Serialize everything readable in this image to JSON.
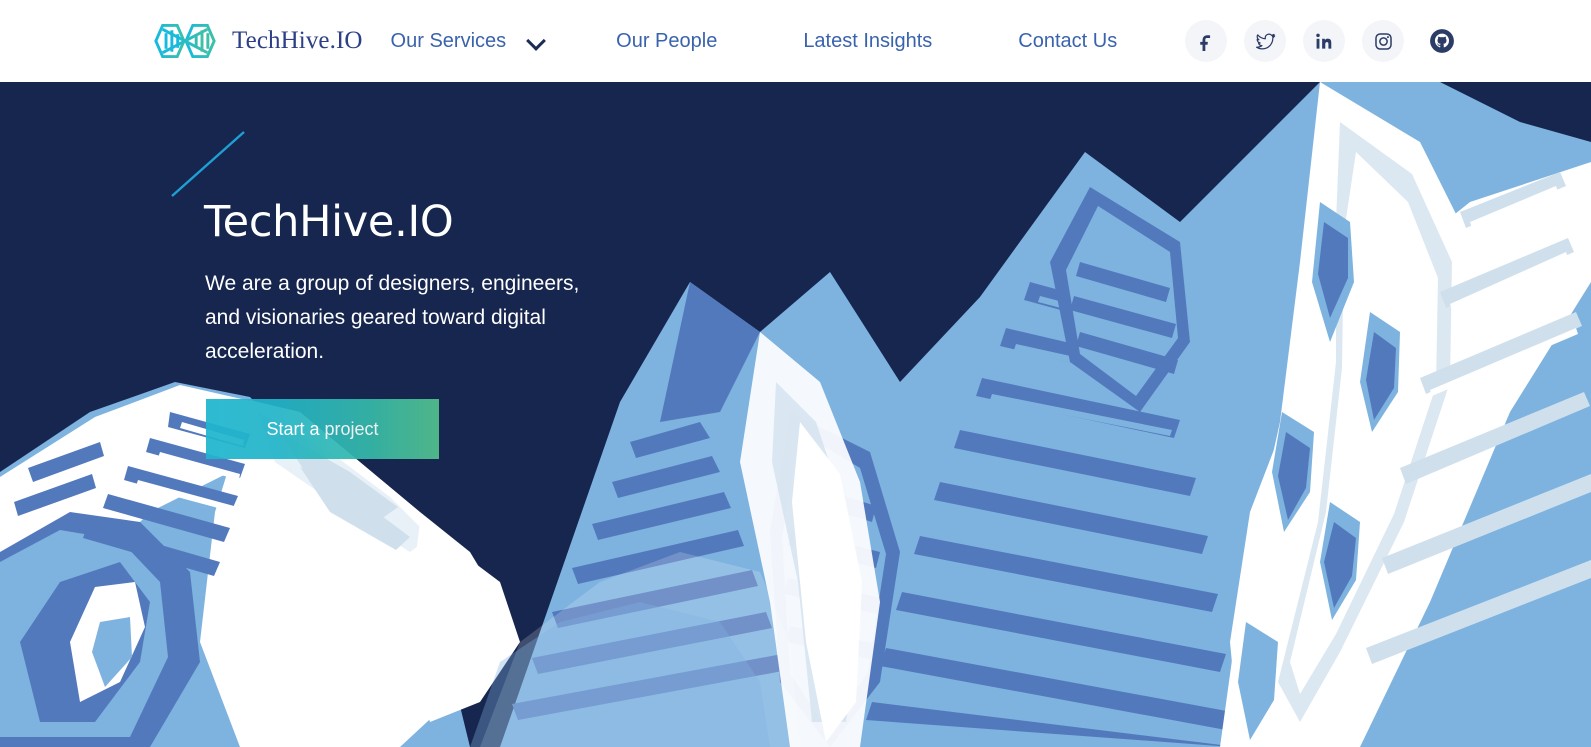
{
  "header": {
    "brand": {
      "name": "TechHive.IO",
      "logo_icon": "infinity-hexagon-logo"
    },
    "nav": [
      {
        "key": "services",
        "label": "Our Services",
        "has_dropdown": true,
        "dropdown_icon": "chevron-down-icon"
      },
      {
        "key": "people",
        "label": "Our People",
        "has_dropdown": false
      },
      {
        "key": "insights",
        "label": "Latest Insights",
        "has_dropdown": false
      },
      {
        "key": "contact",
        "label": "Contact Us",
        "has_dropdown": false
      }
    ],
    "socials": [
      {
        "key": "facebook",
        "icon": "facebook-icon",
        "label": "Facebook"
      },
      {
        "key": "twitter",
        "icon": "twitter-icon",
        "label": "Twitter"
      },
      {
        "key": "linkedin",
        "icon": "linkedin-icon",
        "label": "LinkedIn"
      },
      {
        "key": "instagram",
        "icon": "instagram-icon",
        "label": "Instagram"
      },
      {
        "key": "github",
        "icon": "github-icon",
        "label": "GitHub"
      }
    ]
  },
  "hero": {
    "accent_icon": "diagonal-accent-line",
    "title": "TechHive.IO",
    "subtitle": "We are a group of designers, engineers, and visionaries geared toward digital acceleration.",
    "cta_label": "Start a project",
    "background_illustration": "snow-capped-mountain-range"
  },
  "colors": {
    "navy": "#16264f",
    "brand_text": "#2d3f86",
    "nav_link": "#3a63ad",
    "logo_cyan": "#16b9e0",
    "logo_teal": "#3ec0a8",
    "accent_line": "#1f9fd4",
    "cta_gradient_start": "#1eb6cf",
    "cta_gradient_end": "#53c08d",
    "mountain_light_blue": "#7eb3e0",
    "mountain_mid_blue": "#5379bd",
    "mountain_pale": "#cfe0ec",
    "mountain_snow": "#ffffff",
    "social_bubble": "#f4f5f8",
    "social_glyph": "#2b3d66"
  }
}
